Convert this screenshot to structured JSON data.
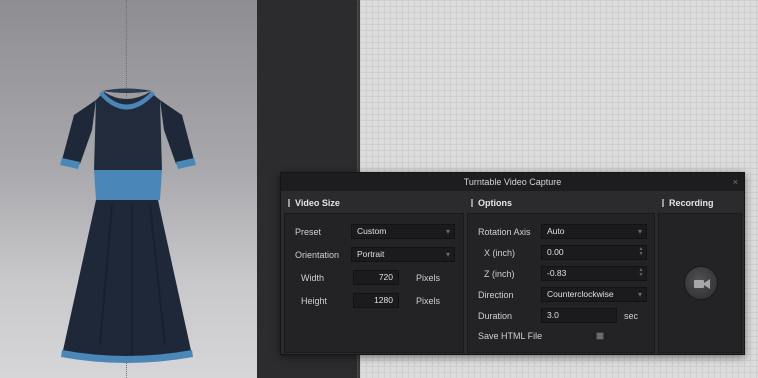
{
  "dialog": {
    "title": "Turntable Video Capture",
    "close_label": "×"
  },
  "video_size": {
    "header": "Video Size",
    "preset_label": "Preset",
    "preset_value": "Custom",
    "orientation_label": "Orientation",
    "orientation_value": "Portrait",
    "width_label": "Width",
    "width_value": "720",
    "width_unit": "Pixels",
    "height_label": "Height",
    "height_value": "1280",
    "height_unit": "Pixels"
  },
  "options": {
    "header": "Options",
    "rotation_axis_label": "Rotation Axis",
    "rotation_axis_value": "Auto",
    "x_label": "X (inch)",
    "x_value": "0.00",
    "z_label": "Z (inch)",
    "z_value": "-0.83",
    "direction_label": "Direction",
    "direction_value": "Counterclockwise",
    "duration_label": "Duration",
    "duration_value": "3.0",
    "duration_unit": "sec",
    "save_html_label": "Save HTML File",
    "save_html_checked": false
  },
  "recording": {
    "header": "Recording",
    "record_icon": "video-camera-icon"
  },
  "colors": {
    "dress_body": "#1f2838",
    "dress_trim": "#4a86b8",
    "dialog_bg": "#2b2b2d",
    "field_bg": "#1b1b1d"
  }
}
